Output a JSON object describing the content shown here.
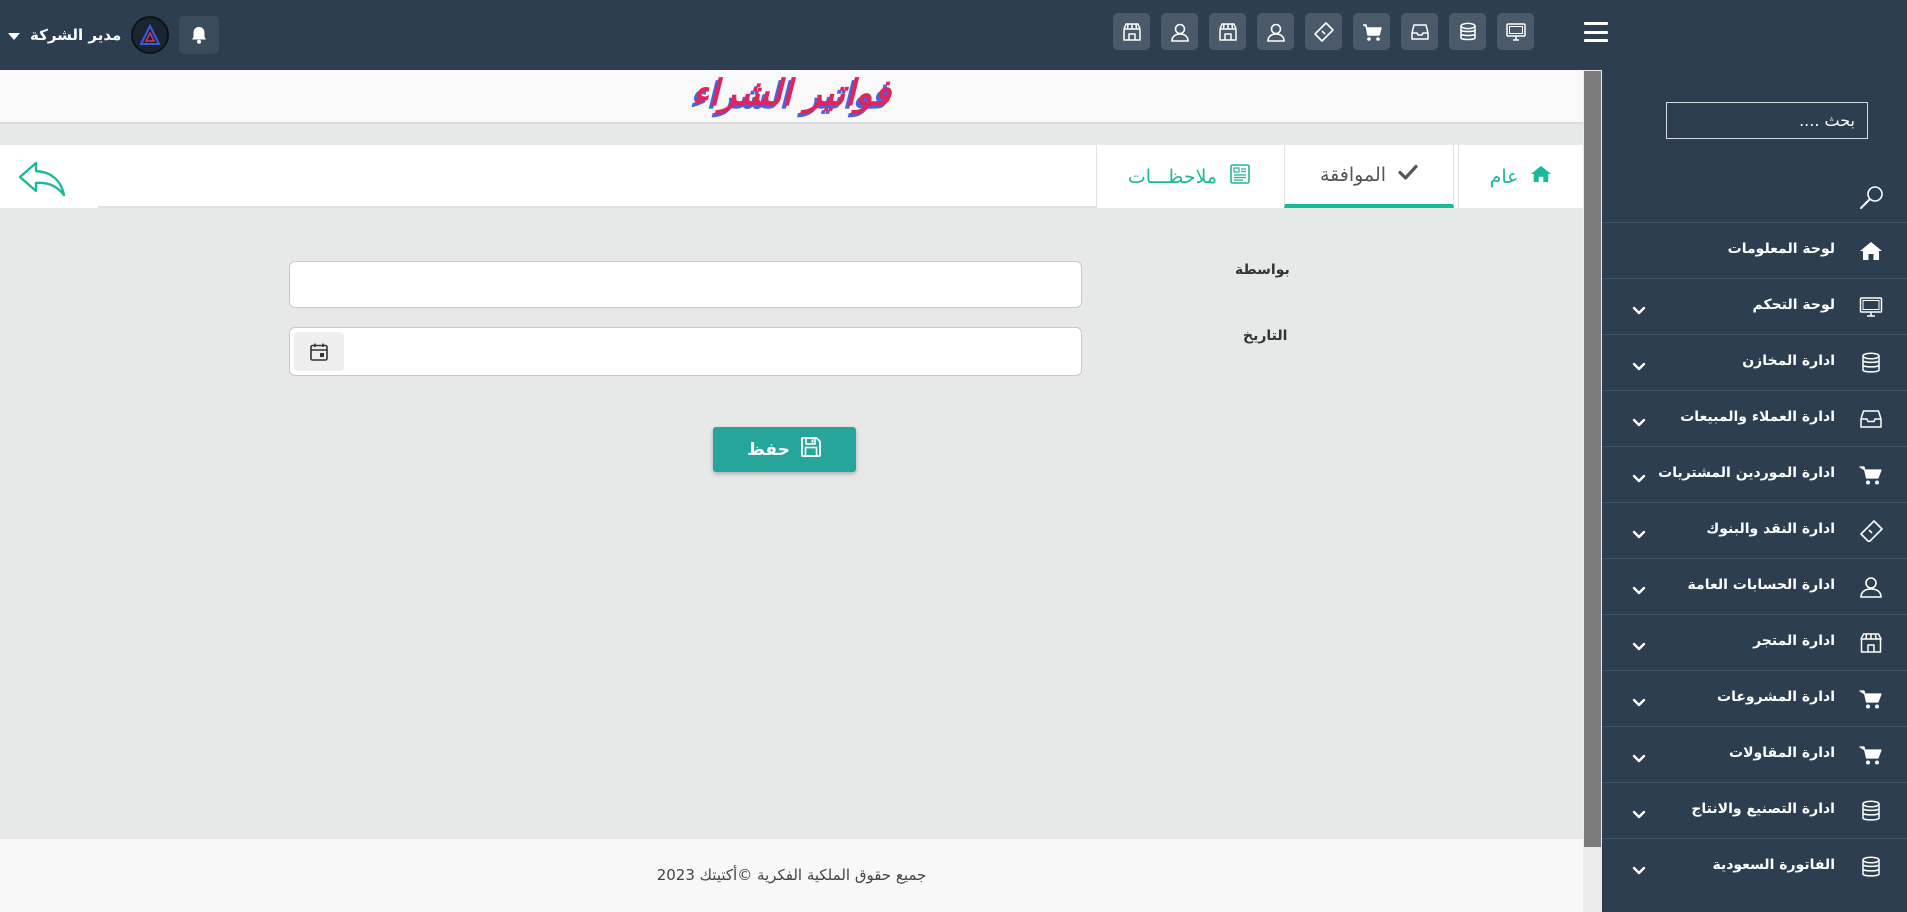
{
  "header": {
    "user_name": "مدير الشركة",
    "quick_icons": [
      "monitor-icon",
      "database-icon",
      "inbox-icon",
      "cart-icon",
      "ticket-icon",
      "user-icon",
      "store-icon",
      "user-icon",
      "store-icon"
    ]
  },
  "sidebar": {
    "search_placeholder": "بحث ....",
    "items": [
      {
        "label": "لوحة المعلومات",
        "icon": "home-icon",
        "has_submenu": false
      },
      {
        "label": "لوحة التحكم",
        "icon": "monitor-icon",
        "has_submenu": true
      },
      {
        "label": "ادارة المخازن",
        "icon": "database-icon",
        "has_submenu": true
      },
      {
        "label": "ادارة العملاء والمبيعات",
        "icon": "inbox-icon",
        "has_submenu": true
      },
      {
        "label": "ادارة الموردين المشتريات",
        "icon": "cart-icon",
        "has_submenu": true
      },
      {
        "label": "ادارة النقد والبنوك",
        "icon": "ticket-icon",
        "has_submenu": true
      },
      {
        "label": "ادارة الحسابات العامة",
        "icon": "user-icon",
        "has_submenu": true
      },
      {
        "label": "ادارة المتجر",
        "icon": "store-icon",
        "has_submenu": true
      },
      {
        "label": "ادارة المشروعات",
        "icon": "cart-icon",
        "has_submenu": true
      },
      {
        "label": "ادارة المقاولات",
        "icon": "cart-icon",
        "has_submenu": true
      },
      {
        "label": "ادارة التصنيع والانتاج",
        "icon": "database-icon",
        "has_submenu": true
      },
      {
        "label": "الفاتورة السعودية",
        "icon": "database-icon",
        "has_submenu": true
      }
    ]
  },
  "page": {
    "title": "فواتير الشراء",
    "tabs": [
      {
        "label": "عام",
        "icon": "home-icon",
        "active": false
      },
      {
        "label": "الموافقة",
        "icon": "check-icon",
        "active": true
      },
      {
        "label": "ملاحظـــات",
        "icon": "newspaper-icon",
        "active": false
      }
    ]
  },
  "form": {
    "by_label": "بواسطة",
    "by_value": "",
    "date_label": "التاريخ",
    "date_value": "",
    "save_label": "حفظ"
  },
  "footer": {
    "copyright": "جميع حقوق الملكية الفكرية ©أكتيتك 2023"
  },
  "colors": {
    "sidebar_bg": "#2c3e50",
    "accent": "#1bb99a",
    "save_button": "#26a69a",
    "title_red": "#e0245e",
    "title_blue": "#4a63e0"
  }
}
